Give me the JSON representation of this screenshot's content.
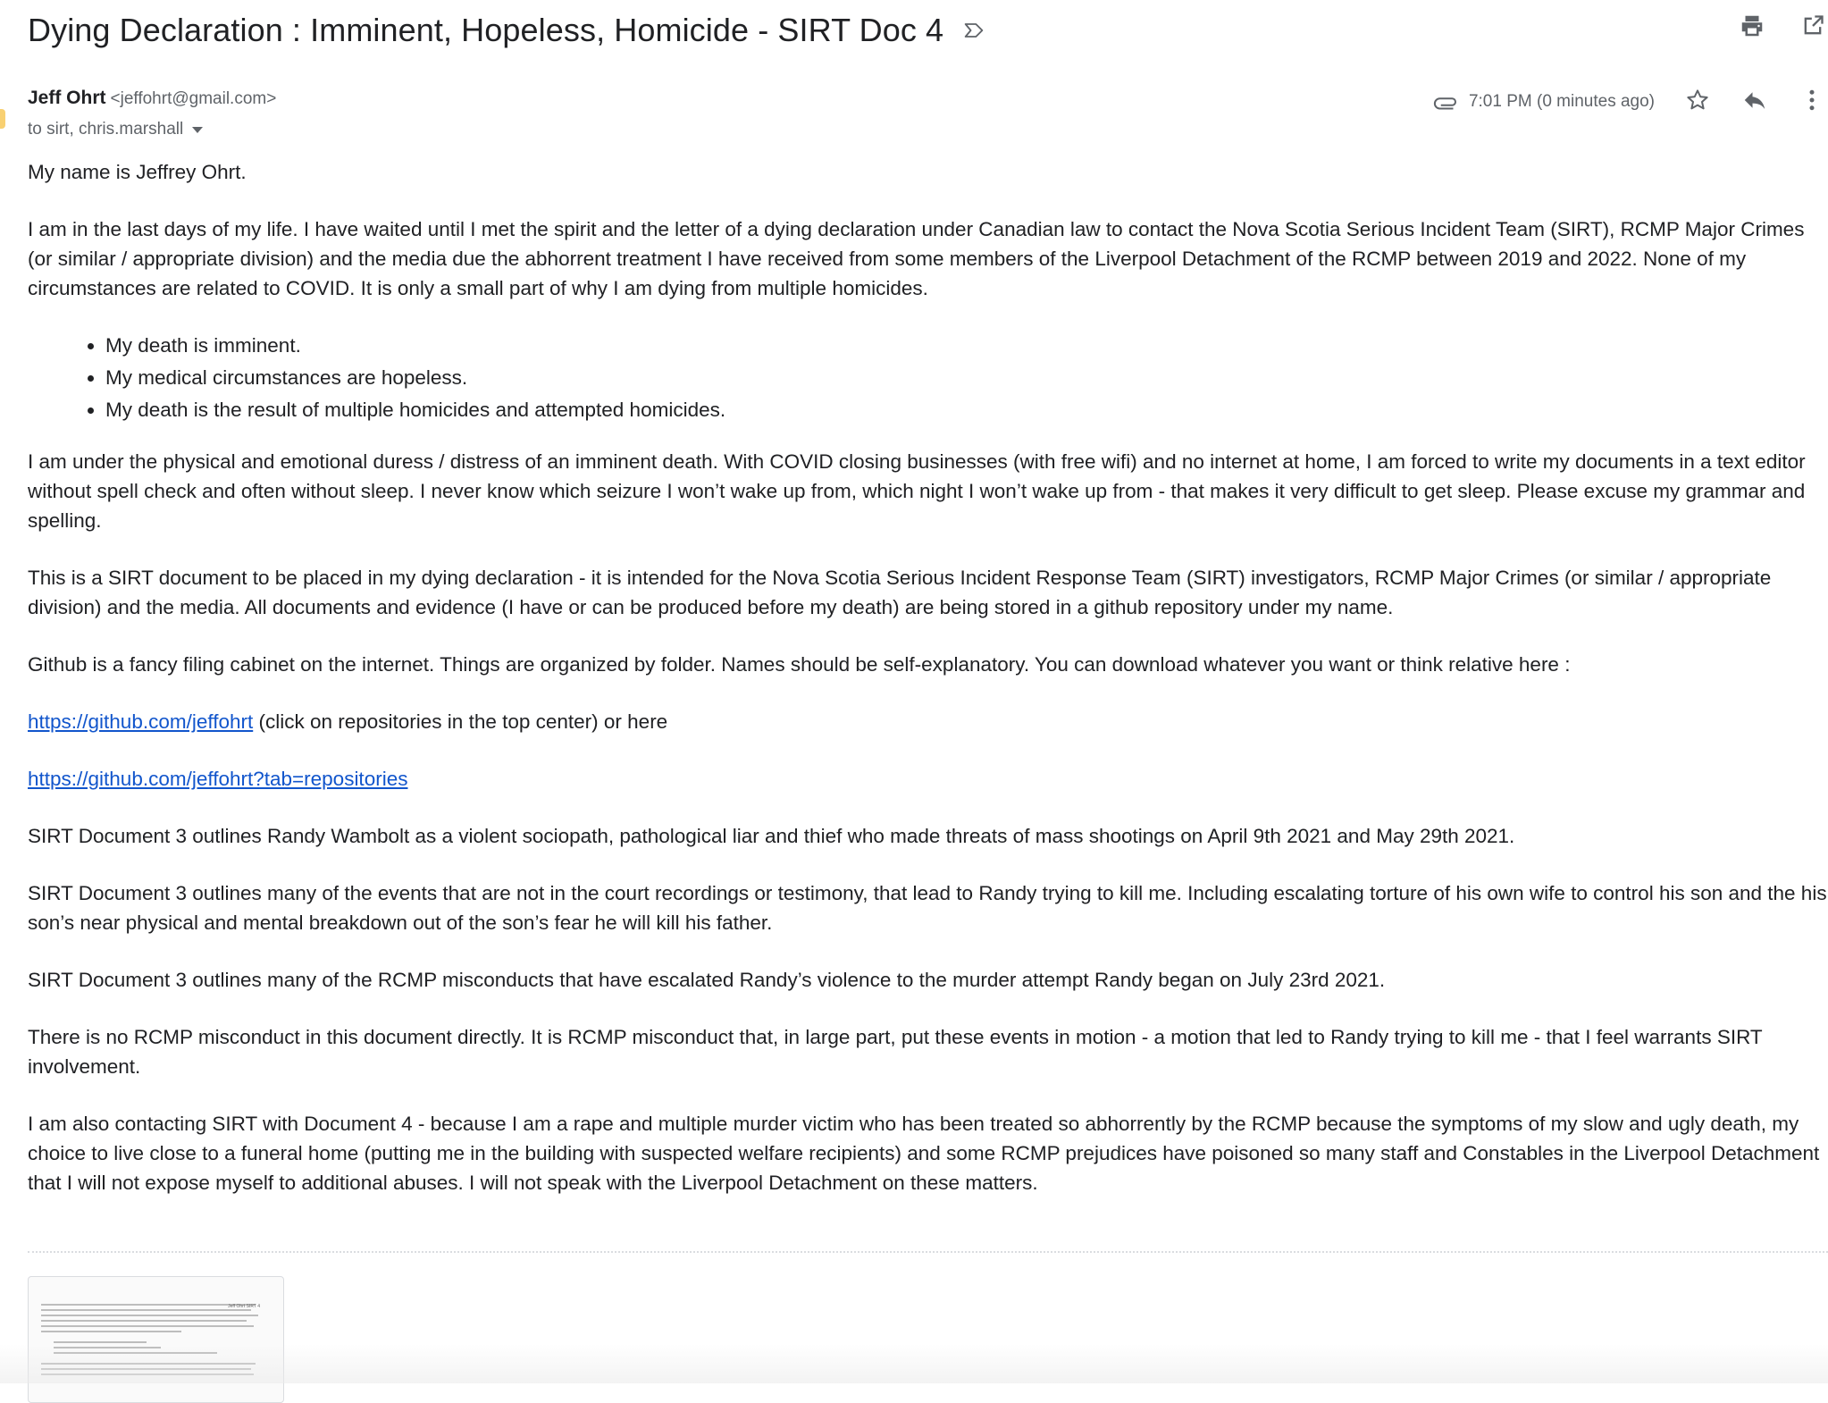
{
  "email": {
    "subject": "Dying Declaration : Imminent, Hopeless, Homicide - SIRT Doc 4",
    "sender_name": "Jeff Ohrt",
    "sender_email": "<jeffohrt@gmail.com>",
    "recipients": "to sirt, chris.marshall",
    "timestamp": "7:01 PM (0 minutes ago)"
  },
  "icons": {
    "label": "label-important-icon",
    "print": "printer-icon",
    "open_new_window": "open-in-new-window-icon",
    "attachment": "paperclip-icon",
    "star": "star-outline-icon",
    "reply": "reply-icon",
    "more": "more-vertical-icon"
  },
  "body": {
    "p1": "My name is Jeffrey Ohrt.",
    "p2": "I am in the last days of my life.  I have waited until I met the spirit and the letter of a dying declaration under Canadian law to contact the Nova Scotia Serious Incident Team (SIRT), RCMP Major Crimes (or similar / appropriate division) and the media due the abhorrent treatment I have received from some members of the Liverpool Detachment of the RCMP between 2019 and 2022.  None of my circumstances are related to COVID.  It is only a small part of why I am dying from multiple homicides.",
    "bullets": [
      "My death is imminent.",
      "My medical circumstances are hopeless.",
      "My death is the result of multiple homicides and attempted homicides."
    ],
    "p3": "I am under the physical and emotional duress / distress of an imminent death.  With COVID closing businesses (with free wifi) and no internet at home, I am forced to write my documents in a text editor without spell check and often without sleep.  I never know which seizure I won’t wake up from, which night I won’t wake up from - that makes it very difficult to get sleep.  Please excuse my grammar and spelling.",
    "p4": "This is a SIRT document to be placed in my dying declaration - it is intended for the Nova Scotia Serious Incident Response Team (SIRT) investigators, RCMP Major Crimes (or similar / appropriate division) and the media.  All documents and evidence (I have or can be produced before my death) are being stored in a github repository under my name.",
    "p5": "Github is a fancy filing cabinet on the internet.  Things are organized by folder.  Names should be self-explanatory.  You can download whatever you want or think relative here :",
    "link1": "https://github.com/jeffohrt",
    "link1_suffix": " (click on repositories in the top center) or here",
    "link2": "https://github.com/jeffohrt?tab=repositories",
    "p6": "SIRT Document 3 outlines Randy Wambolt as a violent sociopath, pathological liar and thief who made threats of mass shootings on April 9th 2021 and May 29th 2021.",
    "p7": "SIRT Document 3 outlines many of the events that are not in the court recordings or testimony, that lead to Randy trying to kill me.  Including escalating torture of his own wife to control his son and the his son’s near physical and mental breakdown out of the son’s fear he will kill his father.",
    "p8": "SIRT Document 3 outlines many of the RCMP misconducts that have escalated Randy’s violence to the murder attempt Randy began on July 23rd 2021.",
    "p9": "There is no RCMP misconduct in this document directly.  It is RCMP misconduct that, in large part, put these events in motion - a motion that led to Randy trying to kill me - that I feel warrants SIRT involvement.",
    "p10": "I am also contacting SIRT with Document 4 - because I am a rape and multiple murder victim who has been treated so abhorrently by the RCMP because the symptoms of my slow and ugly death, my choice to live close to a funeral home (putting me in the building with suspected welfare recipients) and some RCMP prejudices have poisoned so many staff and Constables in the Liverpool Detachment that I will not expose myself to additional abuses.  I will not speak with the Liverpool Detachment on these matters."
  },
  "attachment": {
    "preview_title": "Jeff Ohrt SIRT 4"
  },
  "colors": {
    "link": "#1155cc",
    "text": "#202124",
    "secondary": "#5f6368"
  }
}
